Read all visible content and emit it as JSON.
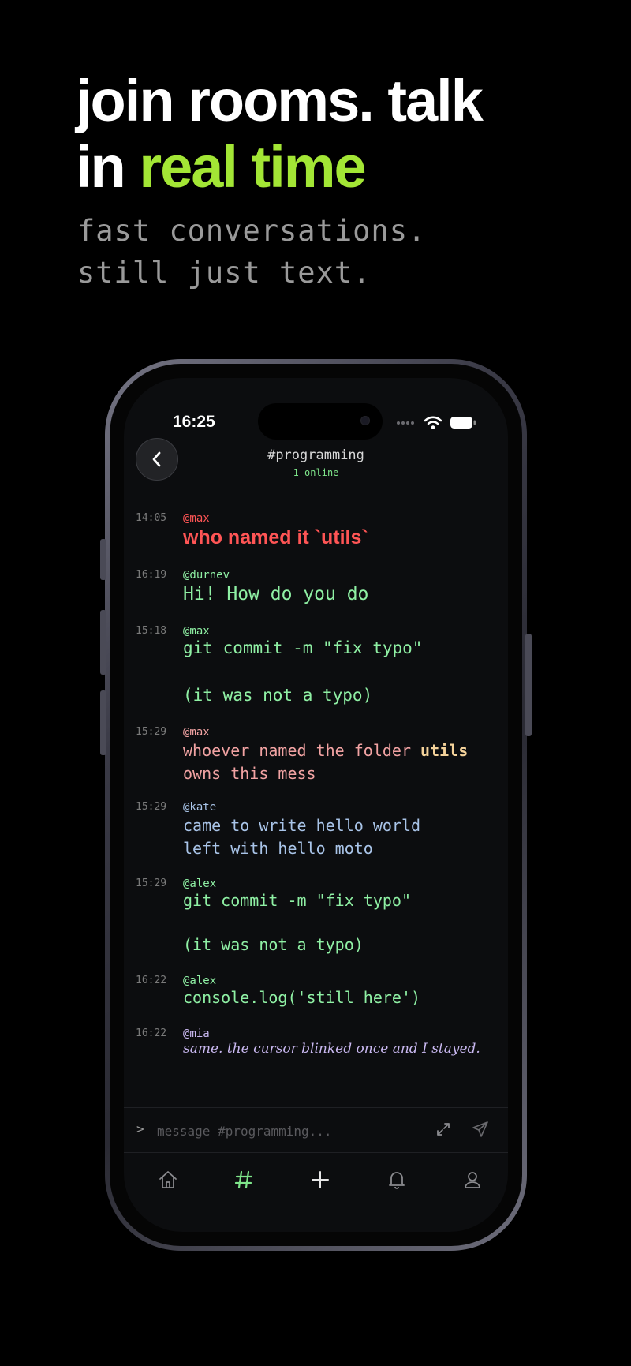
{
  "promo": {
    "headline_line1": "join rooms. talk",
    "headline_in": "in ",
    "headline_accent": "real time",
    "sub_line1": "fast conversations.",
    "sub_line2": "still just text."
  },
  "status_bar": {
    "time": "16:25"
  },
  "room": {
    "name": "#programming",
    "online": "1 online"
  },
  "messages": [
    {
      "time": "14:05",
      "user": "@max",
      "text": "who named it `utils`"
    },
    {
      "time": "16:19",
      "user": "@durnev",
      "text": "Hi! How do you do"
    },
    {
      "time": "15:18",
      "user": "@max",
      "text_line1": "git commit -m \"fix typo\"",
      "text_line2": "(it was not a typo)"
    },
    {
      "time": "15:29",
      "user": "@max",
      "text_part1": "whoever named the folder ",
      "text_highlight": "utils",
      "text_line2": "owns this mess"
    },
    {
      "time": "15:29",
      "user": "@kate",
      "text_line1": "came to write hello world",
      "text_line2": "left with hello moto"
    },
    {
      "time": "15:29",
      "user": "@alex",
      "text_line1": "git commit -m \"fix typo\"",
      "text_line2": "(it was not a typo)"
    },
    {
      "time": "16:22",
      "user": "@alex",
      "text": "console.log('still here')"
    },
    {
      "time": "16:22",
      "user": "@mia",
      "text": "same. the cursor blinked once and I stayed."
    }
  ],
  "composer": {
    "prompt": ">",
    "placeholder": "message #programming..."
  },
  "tabs": [
    "home-icon",
    "hash-icon",
    "plus-icon",
    "bell-icon",
    "profile-icon"
  ],
  "colors": {
    "accent": "#a3e635",
    "max_first": "#ff5555",
    "green": "#8ff0a4",
    "pink": "#f2a3a3",
    "highlight": "#f4d29a",
    "blue": "#a9c4e8",
    "purple": "#c9b8f0"
  }
}
